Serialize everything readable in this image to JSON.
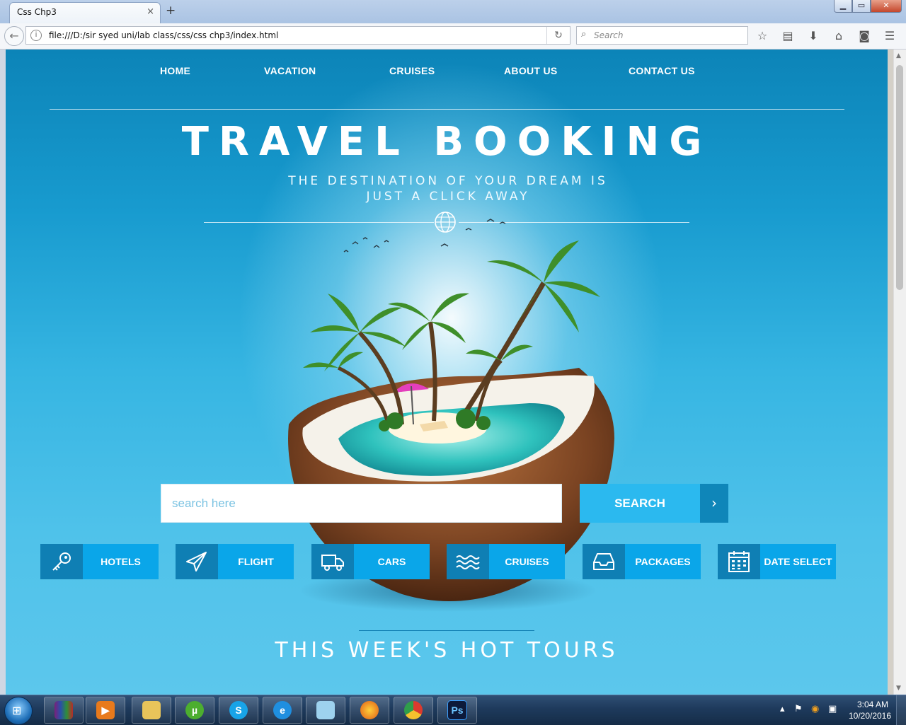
{
  "browser": {
    "tab_title": "Css Chp3",
    "tab_close": "×",
    "new_tab": "+",
    "url": "file:///D:/sir syed uni/lab class/css/css chp3/index.html",
    "search_placeholder": "Search",
    "window_buttons": {
      "minimize": "▁",
      "maximize": "▭",
      "close": "✕"
    }
  },
  "page": {
    "nav": [
      "HOME",
      "VACATION",
      "CRUISES",
      "ABOUT US",
      "CONTACT US"
    ],
    "hero_title": "TRAVEL BOOKING",
    "hero_subtitle": "THE DESTINATION OF YOUR DREAM IS JUST A CLICK AWAY",
    "search": {
      "placeholder": "search here",
      "button_label": "SEARCH",
      "button_arrow": "›"
    },
    "categories": [
      {
        "label": "HOTELS",
        "icon": "key-icon"
      },
      {
        "label": "FLIGHT",
        "icon": "paper-plane-icon"
      },
      {
        "label": "CARS",
        "icon": "truck-icon"
      },
      {
        "label": "CRUISES",
        "icon": "waves-icon"
      },
      {
        "label": "PACKAGES",
        "icon": "inbox-tray-icon"
      },
      {
        "label": "DATE SELECT",
        "icon": "calendar-icon"
      }
    ],
    "hot_tours_title": "THIS WEEK'S HOT TOURS"
  },
  "taskbar": {
    "apps": [
      "winrar",
      "media-player",
      "file-explorer",
      "utorrent",
      "skype",
      "internet-explorer",
      "notepad",
      "firefox",
      "chrome",
      "photoshop"
    ],
    "photoshop_label": "Ps",
    "clock_time": "3:04 AM",
    "clock_date": "10/20/2016"
  },
  "colors": {
    "nav_bg_top": "#0c84b8",
    "page_bg_bottom": "#5cc7ec",
    "search_button": "#2bb9ef",
    "search_arrow": "#0f86b9",
    "category_label": "#0aa6e9",
    "category_icon": "#0f7fb4"
  }
}
